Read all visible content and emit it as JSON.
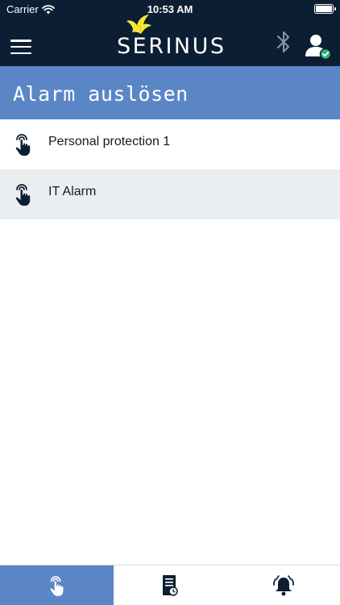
{
  "status_bar": {
    "carrier": "Carrier",
    "time": "10:53 AM"
  },
  "header": {
    "logo_text": "SERINUS",
    "icons": [
      "menu-icon",
      "bluetooth-icon",
      "user-connected-icon"
    ]
  },
  "page": {
    "title": "Alarm auslösen"
  },
  "alarms": [
    {
      "label": "Personal protection 1",
      "icon": "touch-hand-icon"
    },
    {
      "label": "IT Alarm",
      "icon": "touch-hand-icon"
    }
  ],
  "bottom_nav": {
    "tabs": [
      {
        "icon": "touch-hand-icon",
        "active": true
      },
      {
        "icon": "log-document-icon",
        "active": false
      },
      {
        "icon": "alarm-bell-icon",
        "active": false
      }
    ]
  },
  "colors": {
    "header_bg": "#0b1e33",
    "accent": "#5b86c6",
    "list_alt_bg": "#eaeef1",
    "bird_yellow": "#f5e633",
    "check_green": "#2bb673"
  }
}
